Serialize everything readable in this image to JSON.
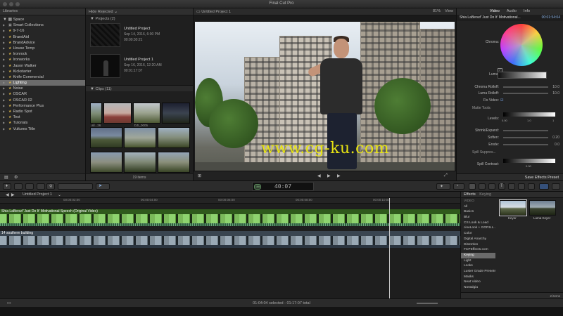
{
  "app": {
    "title": "Final Cut Pro"
  },
  "libraries": {
    "header": "Libraries",
    "root": "Space",
    "items": [
      {
        "label": "Smart Collections",
        "star": false
      },
      {
        "label": "9-7-16",
        "star": true
      },
      {
        "label": "BrandAid",
        "star": true
      },
      {
        "label": "BrandAdvice",
        "star": true
      },
      {
        "label": "House Temp",
        "star": true
      },
      {
        "label": "Ironrock",
        "star": true
      },
      {
        "label": "Ironworks",
        "star": true
      },
      {
        "label": "Jason Walker",
        "star": true
      },
      {
        "label": "Kickstarter",
        "star": true
      },
      {
        "label": "Knife Commercial",
        "star": true
      },
      {
        "label": "Lighting",
        "star": true,
        "selected": true
      },
      {
        "label": "Noise",
        "star": true
      },
      {
        "label": "OSCAR",
        "star": true
      },
      {
        "label": "OSCAR 02",
        "star": true
      },
      {
        "label": "Performance Plus",
        "star": true
      },
      {
        "label": "Radio Spot",
        "star": true
      },
      {
        "label": "Test",
        "star": true
      },
      {
        "label": "Tutorials",
        "star": true
      },
      {
        "label": "Vultures Title",
        "star": true
      }
    ]
  },
  "browser": {
    "filter": "Hide Rejected",
    "projects_header": "Projects",
    "projects_count": "(2)",
    "projects": [
      {
        "name": "Untitled Project",
        "date": "Sep 14, 2016, 6:00 PM",
        "duration": "00:00:30:21"
      },
      {
        "name": "Untitled Project 1",
        "date": "Sep 16, 2016, 12:20 AM",
        "duration": "00:01:17:07"
      }
    ],
    "clips_header": "Clips",
    "clips_count": "(11)",
    "clip_labels": [
      "all...26",
      "",
      "DJI_0005",
      ""
    ],
    "items_count": "19 items"
  },
  "viewer": {
    "project": "Untitled Project 1",
    "zoom": "81%",
    "view_menu": "View",
    "watermark": "www.cg-ku.com"
  },
  "inspector": {
    "tabs": [
      "Video",
      "Audio",
      "Info"
    ],
    "clip_title": "Shia LaBeouf 'Just Do It' Motivational...",
    "clip_time": "00:01:54:04",
    "rows": {
      "chroma": "Chroma:",
      "luma": "Luma:",
      "chroma_rolloff": "Chroma Rolloff:",
      "chroma_rolloff_val": "10.0",
      "luma_rolloff": "Luma Rolloff:",
      "luma_rolloff_val": "10.0",
      "fix_video": "Fix Video:",
      "matte_tools": "Matte Tools:",
      "levels": "Levels:",
      "levels_lo": "0.00",
      "levels_mid": "1.0",
      "levels_hi": "1",
      "shrink_expand": "Shrink/Expand:",
      "softens": "Soften:",
      "softens_val": "0.20",
      "erode": "Erode:",
      "erode_val": "0.0",
      "spill_suppression": "Spill Suppres...",
      "spill_contrast": "Spill Contrast:",
      "spill_contrast_val": "0.00"
    },
    "save_preset": "Save Effects Preset"
  },
  "toolbar": {
    "timecode": "40:07",
    "tc_badge": "100"
  },
  "timeline": {
    "project": "Untitled Project 1",
    "ruler": [
      "00:00:02:00",
      "00:00:04:00",
      "00:00:06:00",
      "00:00:08:00",
      "00:00:10:00"
    ],
    "track1_label": "Shia LaBeouf 'Just Do It' Motivational Speech (Original Video)",
    "track2_label": "14 southern building",
    "status": "01:04:04 selected - 01:17:07 total"
  },
  "effects": {
    "header": "Effects",
    "header_keyword": "Keying",
    "categories": [
      {
        "label": "VIDEO",
        "cat": true
      },
      {
        "label": "All"
      },
      {
        "label": "Basics"
      },
      {
        "label": "Blur"
      },
      {
        "label": "CS Look & Load"
      },
      {
        "label": "cineLook + GORILL..."
      },
      {
        "label": "Color"
      },
      {
        "label": "Digital Anarchy"
      },
      {
        "label": "Distortion"
      },
      {
        "label": "FCPEffects.com"
      },
      {
        "label": "Keying",
        "selected": true
      },
      {
        "label": "Light"
      },
      {
        "label": "Looks"
      },
      {
        "label": "Luster Grade Presets"
      },
      {
        "label": "Masks"
      },
      {
        "label": "Neat Video"
      },
      {
        "label": "Nostalgia"
      }
    ],
    "thumbs": [
      {
        "name": "Keyer",
        "selected": true
      },
      {
        "name": "Luma Keyer",
        "selected": false
      }
    ],
    "count": "2 items"
  },
  "colors": {
    "selection": "#6b6b6b",
    "accent_blue": "#8ab3e6",
    "video_clip_green": "#8ed36f",
    "watermark_yellow": "#e7e312"
  }
}
